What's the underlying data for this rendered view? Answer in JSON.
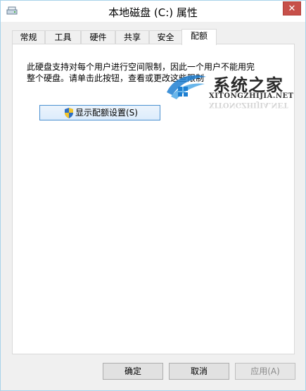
{
  "window": {
    "title": "本地磁盘 (C:) 属性",
    "close_label": "✕"
  },
  "tabs": [
    {
      "label": "常规"
    },
    {
      "label": "工具"
    },
    {
      "label": "硬件"
    },
    {
      "label": "共享"
    },
    {
      "label": "安全"
    },
    {
      "label": "配额",
      "active": true
    }
  ],
  "quota_panel": {
    "description": "此硬盘支持对每个用户进行空间限制，因此一个用户不能用完整个硬盘。请单击此按钮，查看或更改这些限制",
    "show_button_label": "显示配额设置(S)"
  },
  "watermark": {
    "cn": "系统之家",
    "en": "XITONGZHIJIA.NET"
  },
  "footer": {
    "ok": "确定",
    "cancel": "取消",
    "apply": "应用(A)"
  },
  "colors": {
    "window_border": "#a8d3ea",
    "close_button": "#c7504a",
    "button_focus_border": "#4a90d0",
    "watermark_blue": "#1e7fd1"
  }
}
